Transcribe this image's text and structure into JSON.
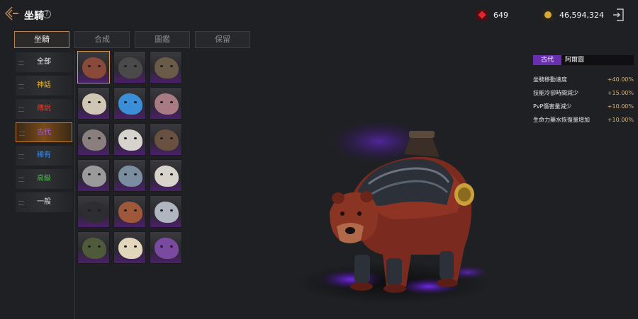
{
  "header": {
    "title": "坐騎",
    "help_symbol": "?",
    "gem_count": "649",
    "gold_count": "46,594,324"
  },
  "tabs": [
    {
      "label": "坐騎",
      "active": true
    },
    {
      "label": "合成",
      "active": false
    },
    {
      "label": "圖鑑",
      "active": false
    },
    {
      "label": "保留",
      "active": false
    }
  ],
  "categories": [
    {
      "label": "全部",
      "color": "#f2f2f2"
    },
    {
      "label": "神話",
      "color": "#e8b83a"
    },
    {
      "label": "傳說",
      "color": "#e03a30"
    },
    {
      "label": "古代",
      "color": "#a55cf0",
      "active": true
    },
    {
      "label": "稀有",
      "color": "#3a8ef0"
    },
    {
      "label": "高級",
      "color": "#4ac04a"
    },
    {
      "label": "一般",
      "color": "#e8e8e8"
    }
  ],
  "mounts": [
    {
      "icon": "red-bear-icon",
      "color": "#8a4a3a",
      "selected": true
    },
    {
      "icon": "black-bull-icon",
      "color": "#4a4a4a"
    },
    {
      "icon": "boar-icon",
      "color": "#6a5a48"
    },
    {
      "icon": "white-lion-icon",
      "color": "#cfc7b4"
    },
    {
      "icon": "blue-dragon-icon",
      "color": "#3b8fd6"
    },
    {
      "icon": "pink-beast-icon",
      "color": "#a87a82"
    },
    {
      "icon": "rhino-icon",
      "color": "#8a7e7e"
    },
    {
      "icon": "white-tiger-icon",
      "color": "#d6d3cc"
    },
    {
      "icon": "spiked-beast-icon",
      "color": "#6a5040"
    },
    {
      "icon": "grey-rhino-icon",
      "color": "#9a9a9a"
    },
    {
      "icon": "armored-tiger-icon",
      "color": "#7a8ea0"
    },
    {
      "icon": "white-lion-2-icon",
      "color": "#d8d4cc"
    },
    {
      "icon": "dark-dragon-icon",
      "color": "#2e2e32"
    },
    {
      "icon": "ox-icon",
      "color": "#a0583a"
    },
    {
      "icon": "silver-dragon-icon",
      "color": "#b0b6c0"
    },
    {
      "icon": "green-dragon-icon",
      "color": "#4e5a3a"
    },
    {
      "icon": "cream-lion-icon",
      "color": "#e2d6bc"
    },
    {
      "icon": "purple-dragon-icon",
      "color": "#7a4aa0"
    }
  ],
  "info": {
    "grade": "古代",
    "name": "阿爾圖",
    "stats": [
      {
        "label": "坐騎移動速度",
        "value": "+40.00%"
      },
      {
        "label": "技能冷卻時間減少",
        "value": "+15.00%"
      },
      {
        "label": "PvP傷害量減少",
        "value": "+10.00%"
      },
      {
        "label": "生命力藥水恢復量增加",
        "value": "+10.00%"
      }
    ]
  },
  "colors": {
    "accent": "#c27a28",
    "ancient": "#6a2fb0",
    "stat_value": "#d6b47a"
  }
}
